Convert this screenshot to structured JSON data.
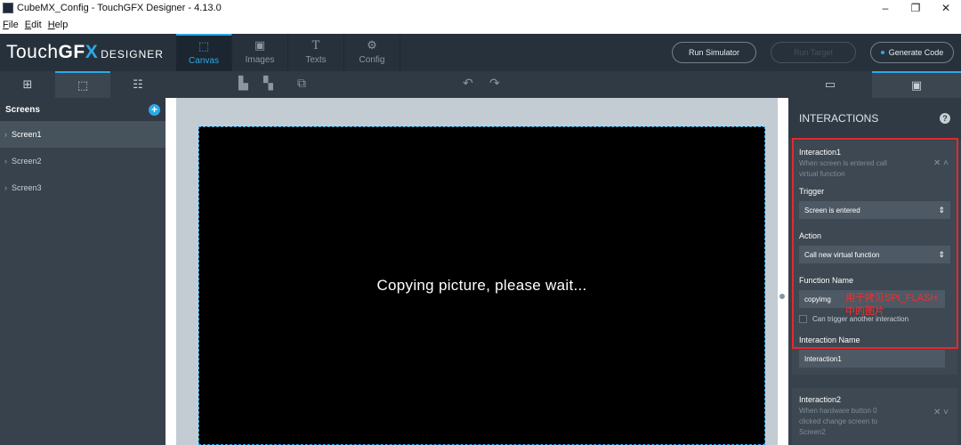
{
  "window": {
    "title": "CubeMX_Config - TouchGFX Designer - 4.13.0",
    "controls": [
      "–",
      "❐",
      "✕"
    ]
  },
  "menu": [
    "File",
    "Edit",
    "Help"
  ],
  "logo": {
    "touch": "Touch",
    "gf": "GF",
    "x": "X",
    "designer": "DESIGNER"
  },
  "main_tabs": [
    {
      "label": "Canvas",
      "glyph": "⬚",
      "icon": "canvas-icon"
    },
    {
      "label": "Images",
      "glyph": "▣",
      "icon": "image-icon"
    },
    {
      "label": "Texts",
      "glyph": "T",
      "icon": "text-icon"
    },
    {
      "label": "Config",
      "glyph": "⚙",
      "icon": "gear-icon"
    }
  ],
  "actions": {
    "run_simulator": "Run Simulator",
    "run_target": "Run Target",
    "generate_code": "Generate Code"
  },
  "sub_tabs": {
    "left": [
      "⊞",
      "⬚",
      "☷"
    ],
    "right": [
      "▭",
      "▣"
    ]
  },
  "toolbar_glyphs": [
    "▙",
    "▚",
    "⧉",
    "↶",
    "↷"
  ],
  "sidebar": {
    "title": "Screens",
    "items": [
      "Screen1",
      "Screen2",
      "Screen3"
    ]
  },
  "canvas": {
    "message": "Copying picture, please wait..."
  },
  "interactions": {
    "title": "INTERACTIONS",
    "interaction1": {
      "name": "Interaction1",
      "description": "When screen is entered call virtual function",
      "trigger_label": "Trigger",
      "trigger_value": "Screen is entered",
      "action_label": "Action",
      "action_value": "Call new virtual function",
      "function_label": "Function Name",
      "function_value": "copyimg",
      "checkbox_label": "Can trigger another interaction",
      "name_label": "Interaction Name",
      "name_value": "Interaction1"
    },
    "interaction2": {
      "name": "Interaction2",
      "description": "When hardware button 0 clicked change screen to Screen2"
    }
  },
  "annotation": {
    "line1": "用于拷贝SPI_FLASH",
    "line2": "中的图片"
  },
  "colors": {
    "accent": "#2da8e6",
    "annotation": "#e8272c"
  }
}
